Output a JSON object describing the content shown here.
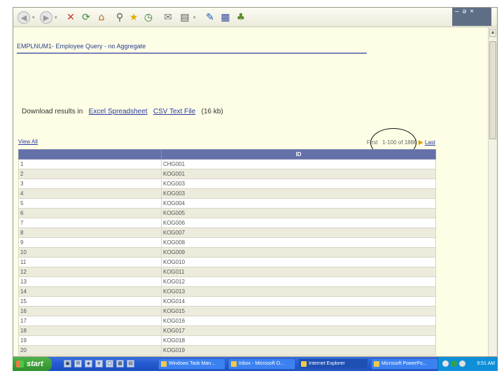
{
  "toolbar": {
    "icons": [
      "back-icon",
      "forward-icon",
      "stop-icon",
      "refresh-icon",
      "home-icon",
      "search-icon",
      "favorites-icon",
      "history-icon",
      "mail-icon",
      "print-icon",
      "edit-icon",
      "messenger-icon"
    ]
  },
  "window_controls": {
    "minimize": "–",
    "maximize": "ǝ",
    "close": "×"
  },
  "page": {
    "title": "EMPLNUM1- Employee Query - no Aggregate",
    "download": {
      "prefix": "Download results in",
      "excel_link": "Excel Spreadsheet",
      "csv_link": "CSV Text File",
      "size": "(16 kb)"
    },
    "view_all": "View All",
    "pager": {
      "first": "First",
      "range": "1-100 of 1886",
      "last": "Last"
    }
  },
  "table": {
    "headers": [
      "",
      "ID"
    ],
    "rows": [
      [
        "1",
        "CHG001"
      ],
      [
        "2",
        "KOG001"
      ],
      [
        "3",
        "KOG003"
      ],
      [
        "4",
        "KOG003"
      ],
      [
        "5",
        "KOG004"
      ],
      [
        "6",
        "KOG005"
      ],
      [
        "7",
        "KOG006"
      ],
      [
        "8",
        "KOG007"
      ],
      [
        "9",
        "KOG008"
      ],
      [
        "10",
        "KOG009"
      ],
      [
        "11",
        "KOG010"
      ],
      [
        "12",
        "KOG011"
      ],
      [
        "13",
        "KOG012"
      ],
      [
        "14",
        "KOG013"
      ],
      [
        "15",
        "KOG014"
      ],
      [
        "16",
        "KOG015"
      ],
      [
        "17",
        "KOG016"
      ],
      [
        "18",
        "KOG017"
      ],
      [
        "19",
        "KOG018"
      ],
      [
        "20",
        "KOG019"
      ]
    ]
  },
  "taskbar": {
    "start_label": "start",
    "tasks": [
      {
        "label": "Windows Task Man..."
      },
      {
        "label": "Inbox - Microsoft O..."
      },
      {
        "label": "Internet Explorer"
      },
      {
        "label": "Microsoft PowerPo..."
      }
    ],
    "clock": "9:51 AM"
  },
  "colors": {
    "header_bg": "#6470a8",
    "link": "#2a3aa0",
    "page_bg": "#fefee6",
    "taskbar": "#245ad0"
  }
}
